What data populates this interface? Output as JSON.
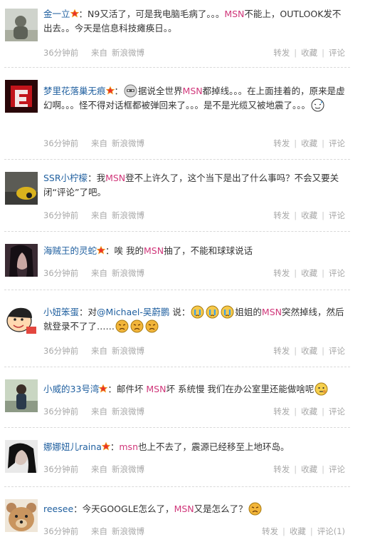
{
  "posts": [
    {
      "user": "金一立",
      "verified": true,
      "segments": [
        {
          "t": "：N9又活了，可是我电脑毛病了。。。"
        },
        {
          "t": "MSN",
          "k": "kw"
        },
        {
          "t": "不能上，OUTLOOK发不出去。。今天是信息科技瘫痪日。。"
        }
      ],
      "time": "36分钟前",
      "from_label": "来自",
      "source": "新浪微博",
      "actions": [
        "转发",
        "收藏",
        "评论"
      ]
    },
    {
      "user": "梦里花落巢无痕",
      "verified": true,
      "segments": [
        {
          "t": "："
        },
        {
          "e": "emoticon-mask"
        },
        {
          "t": "据说全世界"
        },
        {
          "t": "MSN",
          "k": "kw"
        },
        {
          "t": "都掉线。。。在上面挂着的，原来是虚幻啊。。。怪不得对话框都被弹回来了。。。是不是光缆又被地震了。。。"
        },
        {
          "e": "emoticon-sweat"
        }
      ],
      "time": "36分钟前",
      "from_label": "来自",
      "source": "新浪微博",
      "actions": [
        "转发",
        "收藏",
        "评论"
      ]
    },
    {
      "user": "SSR小柠檬",
      "verified": false,
      "segments": [
        {
          "t": "：我"
        },
        {
          "t": "MSN",
          "k": "kw"
        },
        {
          "t": "登不上许久了，这个当下是出了什么事吗？不会又要关闭“评论”了吧。"
        }
      ],
      "time": "36分钟前",
      "from_label": "来自",
      "source": "新浪微博",
      "actions": [
        "转发",
        "收藏",
        "评论"
      ]
    },
    {
      "user": "海贼王的灵蛇",
      "verified": true,
      "segments": [
        {
          "t": "：唉 我的"
        },
        {
          "t": "MSN",
          "k": "kw"
        },
        {
          "t": "抽了，不能和球球说话"
        }
      ],
      "time": "36分钟前",
      "from_label": "来自",
      "source": "新浪微博",
      "actions": [
        "转发",
        "收藏",
        "评论"
      ]
    },
    {
      "user": "小妞笨蛋",
      "verified": false,
      "segments": [
        {
          "t": "：对"
        },
        {
          "t": "@Michael-吴蔚鹏",
          "k": "link"
        },
        {
          "t": " 说："
        },
        {
          "e": "emoticon-cry"
        },
        {
          "e": "emoticon-cry"
        },
        {
          "e": "emoticon-cry"
        },
        {
          "t": "姐姐的"
        },
        {
          "t": "MSN",
          "k": "kw"
        },
        {
          "t": "突然掉线，然后就登录不了了……"
        },
        {
          "e": "emoticon-sad"
        },
        {
          "e": "emoticon-sad"
        },
        {
          "e": "emoticon-sad"
        }
      ],
      "time": "36分钟前",
      "from_label": "来自",
      "source": "新浪微博",
      "actions": [
        "转发",
        "收藏",
        "评论"
      ]
    },
    {
      "user": "小威的33号湾",
      "verified": true,
      "segments": [
        {
          "t": "：邮件坏 "
        },
        {
          "t": "MSN",
          "k": "kw"
        },
        {
          "t": "坏 系统慢 我们在办公室里还能做啥呢"
        },
        {
          "e": "emoticon-think"
        }
      ],
      "time": "36分钟前",
      "from_label": "来自",
      "source": "新浪微博",
      "actions": [
        "转发",
        "收藏",
        "评论"
      ]
    },
    {
      "user": "娜娜妞儿raina",
      "verified": true,
      "segments": [
        {
          "t": "："
        },
        {
          "t": "msn",
          "k": "kw"
        },
        {
          "t": "也上不去了，震源已经移至上地环岛。"
        }
      ],
      "time": "36分钟前",
      "from_label": "来自",
      "source": "新浪微博",
      "actions": [
        "转发",
        "收藏",
        "评论"
      ]
    },
    {
      "user": "reesee",
      "verified": false,
      "segments": [
        {
          "t": "：今天GOOGLE怎么了，"
        },
        {
          "t": "MSN",
          "k": "kw"
        },
        {
          "t": "又是怎么了？"
        },
        {
          "e": "emoticon-sad"
        }
      ],
      "time": "36分钟前",
      "from_label": "来自",
      "source": "新浪微博",
      "actions": [
        "转发",
        "收藏",
        "评论(1)"
      ]
    }
  ]
}
